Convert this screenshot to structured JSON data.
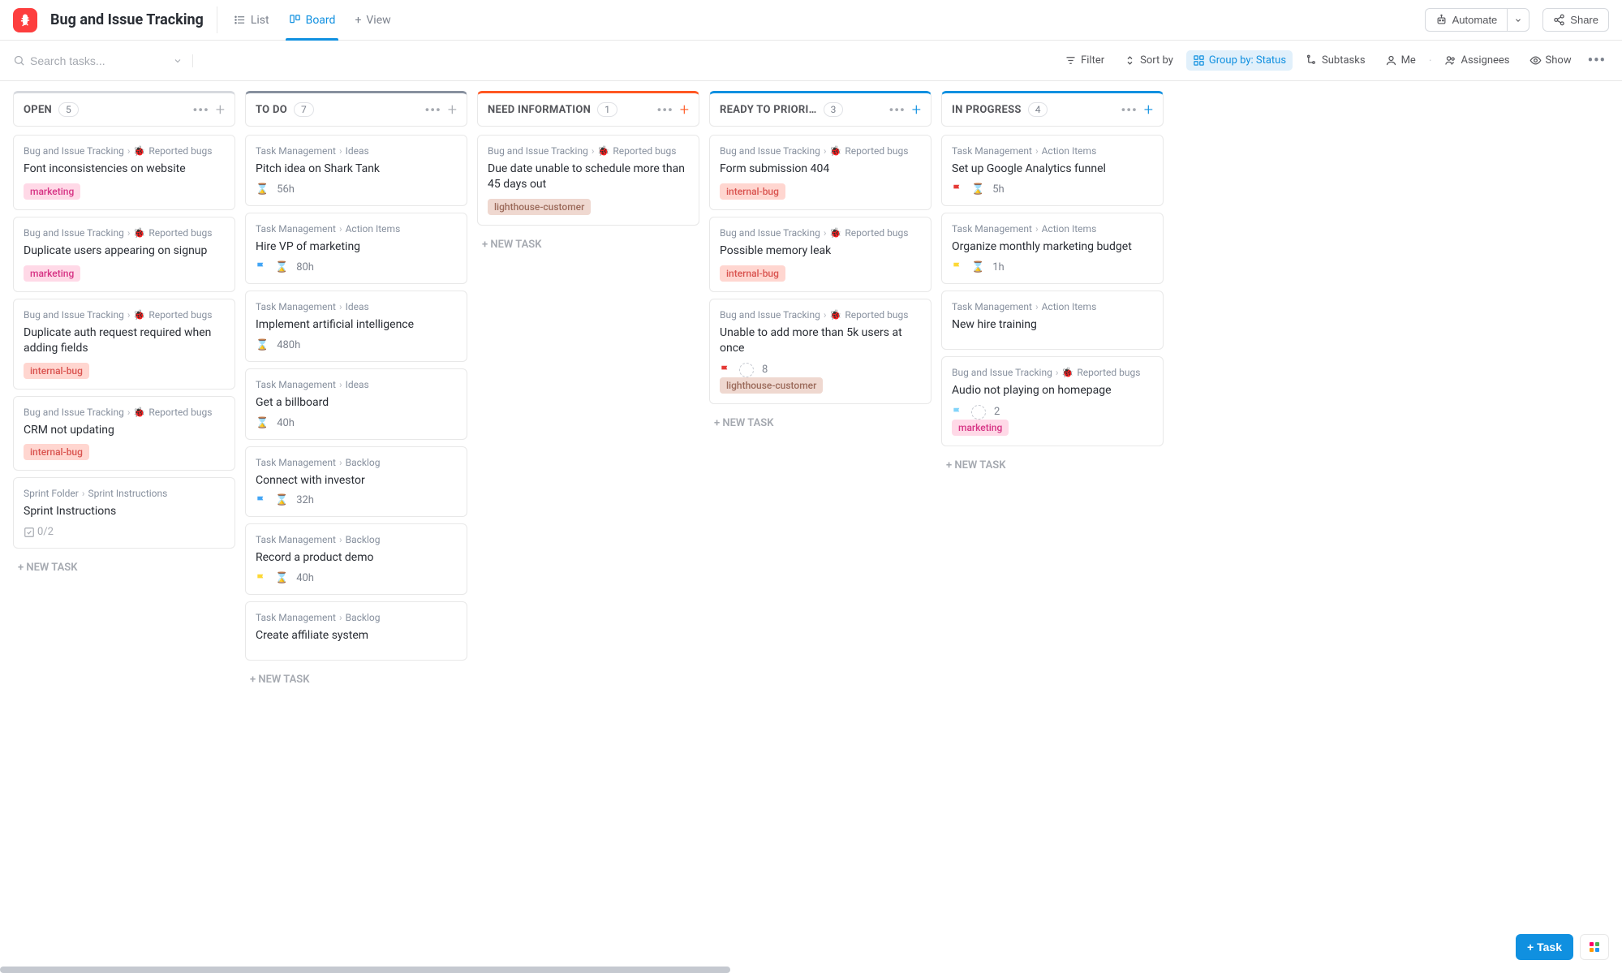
{
  "header": {
    "title": "Bug and Issue Tracking",
    "tabs": {
      "list": "List",
      "board": "Board",
      "view": "View"
    },
    "automate": "Automate",
    "share": "Share"
  },
  "toolbar": {
    "search_placeholder": "Search tasks...",
    "filter": "Filter",
    "sort": "Sort by",
    "group": "Group by: Status",
    "subtasks": "Subtasks",
    "me": "Me",
    "assignees": "Assignees",
    "show": "Show"
  },
  "paths": {
    "bug_tracking": "Bug and Issue Tracking",
    "reported_bugs": "Reported bugs",
    "task_mgmt": "Task Management",
    "ideas": "Ideas",
    "action_items": "Action Items",
    "backlog": "Backlog",
    "sprint_folder": "Sprint Folder",
    "sprint_instructions": "Sprint Instructions"
  },
  "tags": {
    "marketing": "marketing",
    "internal_bug": "internal-bug",
    "lighthouse": "lighthouse-customer"
  },
  "columns": [
    {
      "title": "OPEN",
      "count": "5",
      "style": "col-open",
      "add_style": "",
      "cards": [
        {
          "path": [
            "bug_tracking",
            "reported_bugs"
          ],
          "bug": true,
          "title": "Font inconsistencies on website",
          "tags": [
            "marketing"
          ]
        },
        {
          "path": [
            "bug_tracking",
            "reported_bugs"
          ],
          "bug": true,
          "title": "Duplicate users appearing on signup",
          "tags": [
            "marketing"
          ]
        },
        {
          "path": [
            "bug_tracking",
            "reported_bugs"
          ],
          "bug": true,
          "title": "Duplicate auth request required when adding fields",
          "tags": [
            "internal_bug"
          ]
        },
        {
          "path": [
            "bug_tracking",
            "reported_bugs"
          ],
          "bug": true,
          "title": "CRM not updating",
          "tags": [
            "internal_bug"
          ]
        },
        {
          "path": [
            "sprint_folder",
            "sprint_instructions"
          ],
          "title": "Sprint Instructions",
          "sprint_desc": true,
          "checklist": "0/2"
        }
      ]
    },
    {
      "title": "TO DO",
      "count": "7",
      "style": "col-todo",
      "add_style": "",
      "cards": [
        {
          "path": [
            "task_mgmt",
            "ideas"
          ],
          "title": "Pitch idea on Shark Tank",
          "time": "56h"
        },
        {
          "path": [
            "task_mgmt",
            "action_items"
          ],
          "title": "Hire VP of marketing",
          "flag": "blue",
          "time": "80h"
        },
        {
          "path": [
            "task_mgmt",
            "ideas"
          ],
          "title": "Implement artificial intelligence",
          "time": "480h"
        },
        {
          "path": [
            "task_mgmt",
            "ideas"
          ],
          "title": "Get a billboard",
          "time": "40h"
        },
        {
          "path": [
            "task_mgmt",
            "backlog"
          ],
          "title": "Connect with investor",
          "flag": "blue",
          "time": "32h"
        },
        {
          "path": [
            "task_mgmt",
            "backlog"
          ],
          "title": "Record a product demo",
          "flag": "yellow",
          "time": "40h"
        },
        {
          "path": [
            "task_mgmt",
            "backlog"
          ],
          "title": "Create affiliate system"
        }
      ]
    },
    {
      "title": "NEED INFORMATION",
      "count": "1",
      "style": "col-need",
      "add_style": "need",
      "cards": [
        {
          "path": [
            "bug_tracking",
            "reported_bugs"
          ],
          "bug": true,
          "title": "Due date unable to schedule more than 45 days out",
          "tags": [
            "lighthouse"
          ]
        }
      ]
    },
    {
      "title": "READY TO PRIORI…",
      "count": "3",
      "style": "col-ready",
      "add_style": "ready",
      "cards": [
        {
          "path": [
            "bug_tracking",
            "reported_bugs"
          ],
          "bug": true,
          "title": "Form submission 404",
          "tags": [
            "internal_bug"
          ]
        },
        {
          "path": [
            "bug_tracking",
            "reported_bugs"
          ],
          "bug": true,
          "title": "Possible memory leak",
          "tags": [
            "internal_bug"
          ]
        },
        {
          "path": [
            "bug_tracking",
            "reported_bugs"
          ],
          "bug": true,
          "title": "Unable to add more than 5k users at once",
          "flag": "red",
          "avatar_count": "8",
          "tags": [
            "lighthouse"
          ]
        }
      ]
    },
    {
      "title": "IN PROGRESS",
      "count": "4",
      "style": "col-progress",
      "add_style": "progress",
      "cards": [
        {
          "path": [
            "task_mgmt",
            "action_items"
          ],
          "title": "Set up Google Analytics funnel",
          "flag": "red",
          "time": "5h"
        },
        {
          "path": [
            "task_mgmt",
            "action_items"
          ],
          "title": "Organize monthly marketing budget",
          "flag": "yellow",
          "time": "1h"
        },
        {
          "path": [
            "task_mgmt",
            "action_items"
          ],
          "title": "New hire training"
        },
        {
          "path": [
            "bug_tracking",
            "reported_bugs"
          ],
          "bug": true,
          "title": "Audio not playing on homepage",
          "flag": "lightblue",
          "avatar_count": "2",
          "tags": [
            "marketing"
          ]
        }
      ]
    }
  ],
  "new_task_label": "+ NEW TASK",
  "task_button": "Task"
}
